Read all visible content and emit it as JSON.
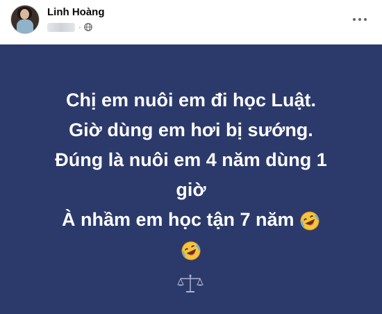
{
  "post": {
    "author": "Linh Hoàng",
    "separator": "·",
    "lines": [
      "Chị em nuôi em đi học Luật.",
      "Giờ dùng em hơi bị sướng.",
      "Đúng là nuôi em 4 năm dùng 1",
      "giờ",
      "À nhầm em học tận 7 năm"
    ],
    "emoji_icon": "rolling-on-the-floor-laughing-emoji",
    "background_color": "#2c3a6b",
    "text_color": "#ffffff",
    "footer_icon": "scales-of-justice-icon"
  }
}
